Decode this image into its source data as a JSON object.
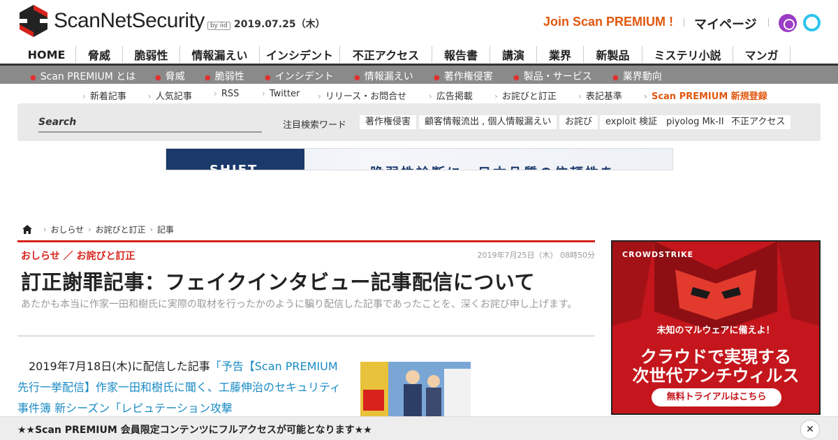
{
  "header": {
    "logo_text": "ScanNetSecurity",
    "logo_by": "by iid",
    "date": "2019.07.25（木）",
    "join_label": "Join Scan PREMIUM !",
    "mypage_label": "マイページ",
    "icons": [
      "podcast-icon",
      "alexa-icon"
    ]
  },
  "main_nav": [
    {
      "label": "HOME",
      "active": true
    },
    {
      "label": "脅威"
    },
    {
      "label": "脆弱性"
    },
    {
      "label": "情報漏えい"
    },
    {
      "label": "インシデント"
    },
    {
      "label": "不正アクセス"
    },
    {
      "label": "報告書"
    },
    {
      "label": "講演"
    },
    {
      "label": "業界"
    },
    {
      "label": "新製品"
    },
    {
      "label": "ミステリ小説"
    },
    {
      "label": "マンガ"
    }
  ],
  "sub_nav": [
    "Scan PREMIUM とは",
    "脅威",
    "脆弱性",
    "インシデント",
    "情報漏えい",
    "著作権侵害",
    "製品・サービス",
    "業界動向"
  ],
  "util_nav": [
    "新着記事",
    "人気記事",
    "RSS",
    "Twitter",
    "リリース・お問合せ",
    "広告掲載",
    "お詫びと訂正",
    "表記基準",
    "Scan PREMIUM 新規登録"
  ],
  "search": {
    "placeholder": "Search",
    "trend_label": "注目検索ワード",
    "tags": [
      "著作権侵害",
      "顧客情報流出 , 個人情報漏えい",
      "お詫び",
      "exploit 検証",
      "piyolog Mk-II",
      "不正アクセス"
    ]
  },
  "banner": {
    "left_text": "SHIFT",
    "main_text": "脆弱性診断に　日本品質の信頼性を"
  },
  "breadcrumb": [
    "おしらせ",
    "お詫びと訂正",
    "記事"
  ],
  "article": {
    "category": "おしらせ ／ お詫びと訂正",
    "date": "2019年7月25日（木） 08時50分",
    "title": "訂正謝罪記事：フェイクインタビュー記事配信について",
    "lead": "あたかも本当に作家一田和樹氏に実際の取材を行ったかのように騙り配信した記事であったことを、深くお詫び申し上げます。",
    "body_prefix": "　2019年7月18日(木)に配信した記事",
    "body_link": "「予告【Scan PREMIUM 先行一挙配信】作家一田和樹氏に聞く、工藤伸治のセキュリティ事件簿 新シーズン「レピュテーション攻撃"
  },
  "ad": {
    "brand": "CROWDSTRIKE",
    "small": "未知のマルウェアに備えよ！",
    "big1": "クラウドで実現する",
    "big2": "次世代アンチウィルス",
    "cta": "無料トライアルはこちら"
  },
  "bottom_bar": {
    "text": "★★Scan PREMIUM 会員限定コンテンツにフルアクセスが可能となります★★",
    "close": "✕"
  },
  "colors": {
    "accent_red": "#d7231b",
    "join_orange": "#e0580f",
    "link_blue": "#1a8bc4",
    "subnav_gray": "#8a8a8a"
  }
}
